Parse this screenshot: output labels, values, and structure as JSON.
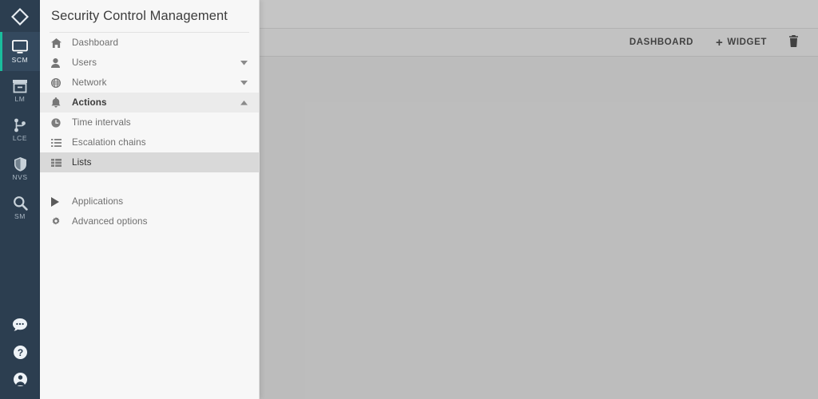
{
  "theme": {
    "rail_bg": "#2c3e50",
    "rail_active_bg": "#34495e",
    "accent": "#1abc9c",
    "panel_bg": "#f7f7f7",
    "selected_bg": "#ebebeb",
    "current_bg": "#d9d9d9",
    "scrim": "rgba(80,80,80,0.33)"
  },
  "rail": {
    "logo_icon": "diamond-logo-icon",
    "items": [
      {
        "label": "SCM",
        "icon": "monitor-icon",
        "active": true
      },
      {
        "label": "LM",
        "icon": "archive-box-icon",
        "active": false
      },
      {
        "label": "LCE",
        "icon": "sitemap-branch-icon",
        "active": false
      },
      {
        "label": "NVS",
        "icon": "shield-icon",
        "active": false
      },
      {
        "label": "SM",
        "icon": "magnifier-icon",
        "active": false
      }
    ],
    "bottom_items": [
      {
        "name": "chat-bubble-icon"
      },
      {
        "name": "help-circle-icon"
      },
      {
        "name": "user-account-icon"
      }
    ]
  },
  "panel": {
    "title": "Security Control Management",
    "items": [
      {
        "label": "Dashboard",
        "icon": "home-icon",
        "caret": "",
        "state": ""
      },
      {
        "label": "Users",
        "icon": "user-icon",
        "caret": "down",
        "state": ""
      },
      {
        "label": "Network",
        "icon": "globe-icon",
        "caret": "down",
        "state": ""
      },
      {
        "label": "Actions",
        "icon": "bell-icon",
        "caret": "up",
        "state": "selected"
      },
      {
        "label": "Time intervals",
        "icon": "clock-icon",
        "caret": "",
        "state": "sub"
      },
      {
        "label": "Escalation chains",
        "icon": "list-icon",
        "caret": "",
        "state": "sub"
      },
      {
        "label": "Lists",
        "icon": "grid-list-icon",
        "caret": "",
        "state": "sub current"
      }
    ],
    "footer_items": [
      {
        "label": "Applications",
        "icon": "play-triangle-icon",
        "caret": "",
        "state": ""
      },
      {
        "label": "Advanced options",
        "icon": "gear-icon",
        "caret": "",
        "state": ""
      }
    ]
  },
  "toolbar": {
    "dashboard_label": "DASHBOARD",
    "widget_label": "WIDGET",
    "widget_plus": "+",
    "delete_icon": "trash-icon"
  }
}
